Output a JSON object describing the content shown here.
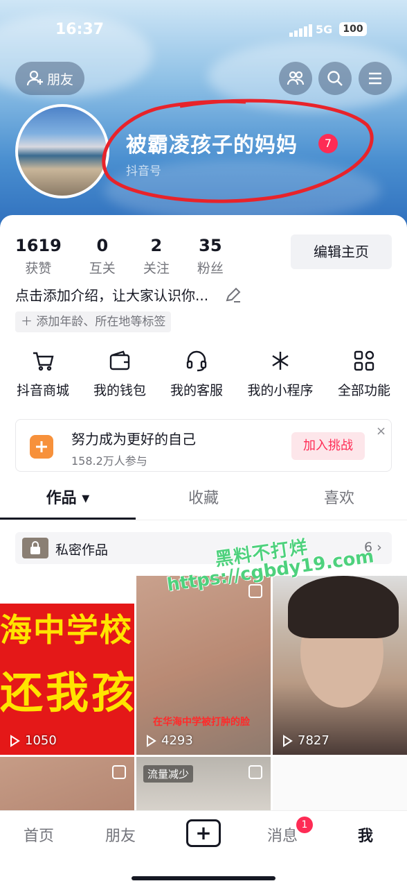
{
  "status_bar": {
    "time": "16:37",
    "network": "5G",
    "battery": "100"
  },
  "header": {
    "friend_button": "朋友",
    "nickname": "被霸凌孩子的妈妈",
    "badge_count": "7",
    "douyin_id_label": "抖音号"
  },
  "stats": [
    {
      "value": "1619",
      "label": "获赞"
    },
    {
      "value": "0",
      "label": "互关"
    },
    {
      "value": "2",
      "label": "关注"
    },
    {
      "value": "35",
      "label": "粉丝"
    }
  ],
  "edit_button": "编辑主页",
  "bio": "点击添加介绍，让大家认识你...",
  "tag_hint": "＋ 添加年龄、所在地等标签",
  "functions": [
    {
      "label": "抖音商城",
      "icon": "cart-icon"
    },
    {
      "label": "我的钱包",
      "icon": "wallet-icon"
    },
    {
      "label": "我的客服",
      "icon": "headset-icon"
    },
    {
      "label": "我的小程序",
      "icon": "mini-program-icon"
    },
    {
      "label": "全部功能",
      "icon": "grid-icon"
    }
  ],
  "challenge": {
    "title": "努力成为更好的自己",
    "participants": "158.2万人参与",
    "button": "加入挑战",
    "close": "×"
  },
  "tabs": [
    {
      "label": "作品 ▾",
      "active": true
    },
    {
      "label": "收藏",
      "active": false
    },
    {
      "label": "喜欢",
      "active": false
    }
  ],
  "private_works": {
    "label": "私密作品",
    "count": "6 ›"
  },
  "watermark": {
    "line1": "黑料不打烊",
    "line2": "https://cgbdy19.com"
  },
  "videos": [
    {
      "plays": "1050",
      "text1": "海中学校园",
      "text2": "还我孩"
    },
    {
      "plays": "4293",
      "caption": "在华海中学被打肿的脸"
    },
    {
      "plays": "7827"
    },
    {
      "plays": ""
    },
    {
      "plays": "",
      "label": "流量减少"
    },
    {
      "plays": ""
    }
  ],
  "bottom_nav": {
    "home": "首页",
    "friends": "朋友",
    "plus": "+",
    "messages": "消息",
    "messages_badge": "1",
    "me": "我"
  }
}
